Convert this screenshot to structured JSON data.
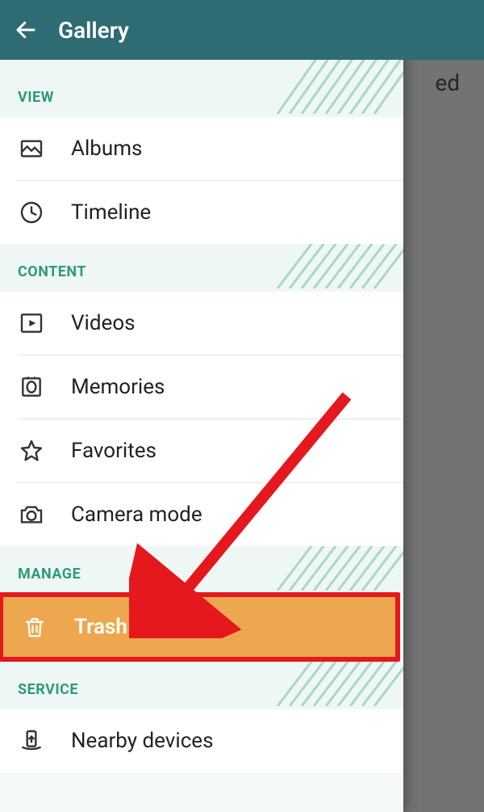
{
  "header": {
    "title": "Gallery"
  },
  "backdrop": {
    "partial_text": "ed"
  },
  "sections": {
    "view": {
      "label": "VIEW",
      "items": {
        "albums": "Albums",
        "timeline": "Timeline"
      }
    },
    "content": {
      "label": "CONTENT",
      "items": {
        "videos": "Videos",
        "memories": "Memories",
        "favorites": "Favorites",
        "camera_mode": "Camera mode"
      }
    },
    "manage": {
      "label": "MANAGE",
      "items": {
        "trash": "Trash"
      }
    },
    "service": {
      "label": "SERVICE",
      "items": {
        "nearby": "Nearby devices"
      }
    }
  },
  "annotation": {
    "highlight_color": "#e4181d",
    "arrow_color": "#e4181d"
  }
}
